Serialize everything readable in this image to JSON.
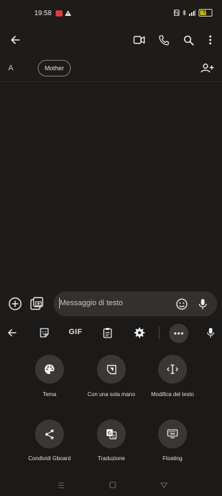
{
  "status_bar": {
    "time": "19:58",
    "battery": "57"
  },
  "contact": {
    "avatar_letter": "A",
    "chip_label": "Mother"
  },
  "composer": {
    "placeholder": "Messaggio di testo"
  },
  "keyboard": {
    "toolbar": {
      "gif_label": "GIF"
    },
    "actions": [
      {
        "label": "Tema",
        "icon": "palette-icon"
      },
      {
        "label": "Con una sola mano",
        "icon": "one-hand-icon"
      },
      {
        "label": "Modifica del testo",
        "icon": "text-cursor-icon"
      },
      {
        "label": "Condividi Gboard",
        "icon": "share-icon"
      },
      {
        "label": "Traduzione",
        "icon": "translate-icon"
      },
      {
        "label": "Floating",
        "icon": "floating-keyboard-icon"
      }
    ]
  },
  "colors": {
    "background": "#1e1b19",
    "accent": "#b9c6ff",
    "notification": "#e53935",
    "battery": "#c6b600"
  }
}
